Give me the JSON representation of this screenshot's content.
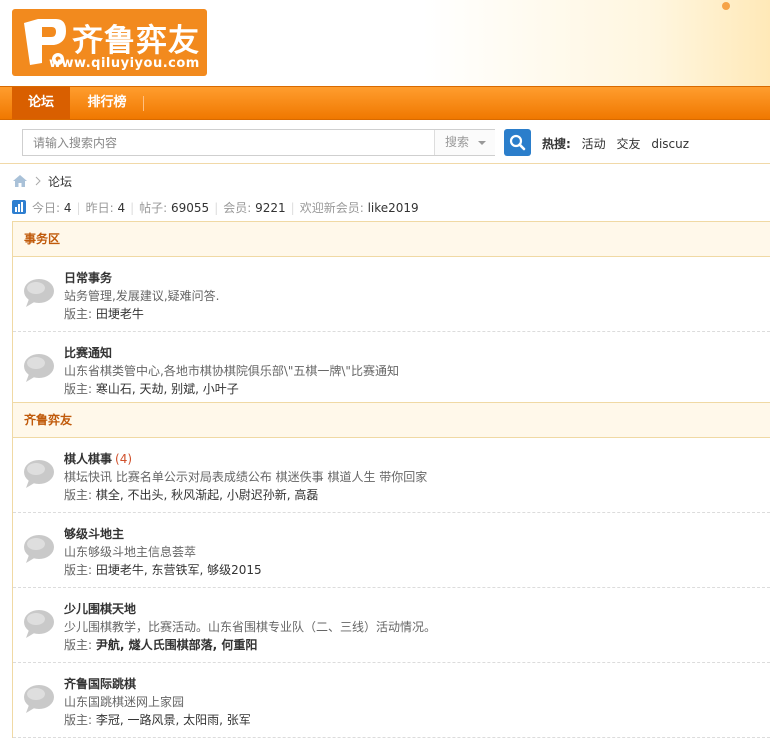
{
  "logo": {
    "name": "齐鲁弈友",
    "url": "www.qiluyiyou.com"
  },
  "nav": {
    "items": [
      {
        "label": "论坛",
        "active": true
      },
      {
        "label": "排行榜",
        "active": false
      }
    ]
  },
  "search": {
    "placeholder": "请输入搜索内容",
    "type_label": "搜索",
    "hot_label": "热搜:",
    "hot_links": [
      "活动",
      "交友",
      "discuz"
    ]
  },
  "breadcrumb": {
    "current": "论坛"
  },
  "stats": {
    "today_label": "今日:",
    "today": "4",
    "yesterday_label": "昨日:",
    "yesterday": "4",
    "posts_label": "帖子:",
    "posts": "69055",
    "members_label": "会员:",
    "members": "9221",
    "newest_label": "欢迎新会员:",
    "newest": "like2019"
  },
  "categories": [
    {
      "name": "事务区",
      "forums": [
        {
          "title": "日常事务",
          "count": "",
          "desc": "站务管理,发展建议,疑难问答.",
          "mods_label": "版主:",
          "mods": "田埂老牛",
          "mods_bold": false
        },
        {
          "title": "比赛通知",
          "count": "",
          "desc": "山东省棋类管中心,各地市棋协棋院俱乐部\\\"五棋一牌\\\"比赛通知",
          "mods_label": "版主:",
          "mods": "寒山石, 天劫, 别斌, 小叶子",
          "mods_bold": false
        }
      ]
    },
    {
      "name": "齐鲁弈友",
      "forums": [
        {
          "title": "棋人棋事",
          "count": "(4)",
          "desc": "棋坛快讯 比赛名单公示对局表成绩公布 棋迷佚事 棋道人生 带你回家",
          "mods_label": "版主:",
          "mods": "棋全, 不出头, 秋风渐起, 小尉迟孙新, 高磊",
          "mods_bold": false
        },
        {
          "title": "够级斗地主",
          "count": "",
          "desc": "山东够级斗地主信息荟萃",
          "mods_label": "版主:",
          "mods": "田埂老牛, 东营铁军, 够级2015",
          "mods_bold": false
        },
        {
          "title": "少儿围棋天地",
          "count": "",
          "desc": "少儿围棋教学，比赛活动。山东省围棋专业队（二、三线）活动情况。",
          "mods_label": "版主:",
          "mods": "尹航, 燧人氏围棋部落, 何重阳",
          "mods_bold": true
        },
        {
          "title": "齐鲁国际跳棋",
          "count": "",
          "desc": "山东国跳棋迷网上家园",
          "mods_label": "版主:",
          "mods": "李冠, 一路风景, 太阳雨, 张军",
          "mods_bold": false
        }
      ]
    }
  ],
  "colors": {
    "nav_orange": "#f07800",
    "nav_active": "#d95f00",
    "category_text": "#c05a0b",
    "search_button": "#2b7ecb",
    "thread_count": "#d0502b"
  }
}
